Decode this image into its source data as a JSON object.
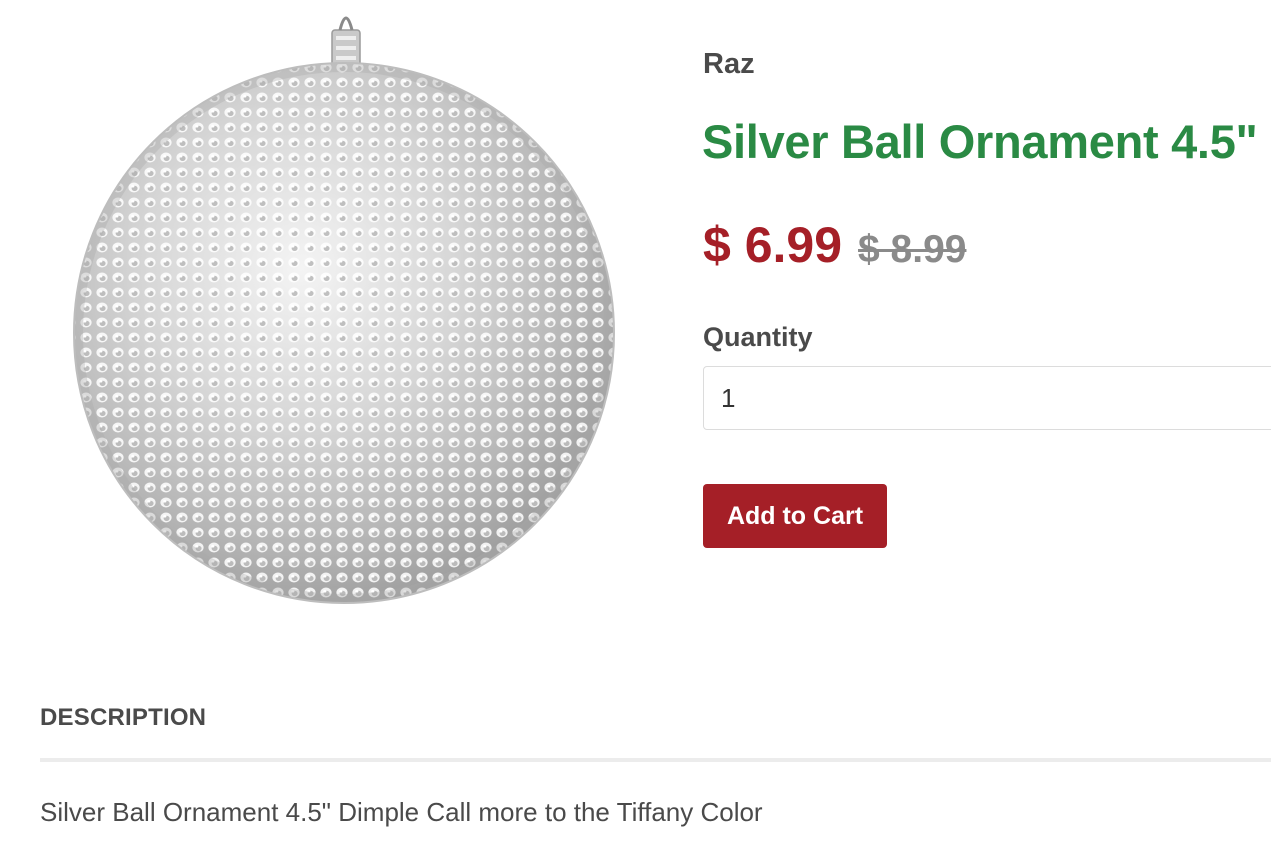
{
  "product": {
    "vendor": "Raz",
    "title": "Silver Ball Ornament 4.5\"",
    "price": "$ 6.99",
    "compare_at_price": "$ 8.99",
    "image_icon": "silver-ornament-image"
  },
  "form": {
    "quantity_label": "Quantity",
    "quantity_value": "1",
    "add_to_cart_label": "Add to Cart"
  },
  "description": {
    "heading": "DESCRIPTION",
    "text": "Silver Ball Ornament 4.5\" Dimple Call more to the Tiffany Color"
  },
  "colors": {
    "title": "#2a8a44",
    "price": "#a51f27",
    "button": "#a51f27"
  }
}
